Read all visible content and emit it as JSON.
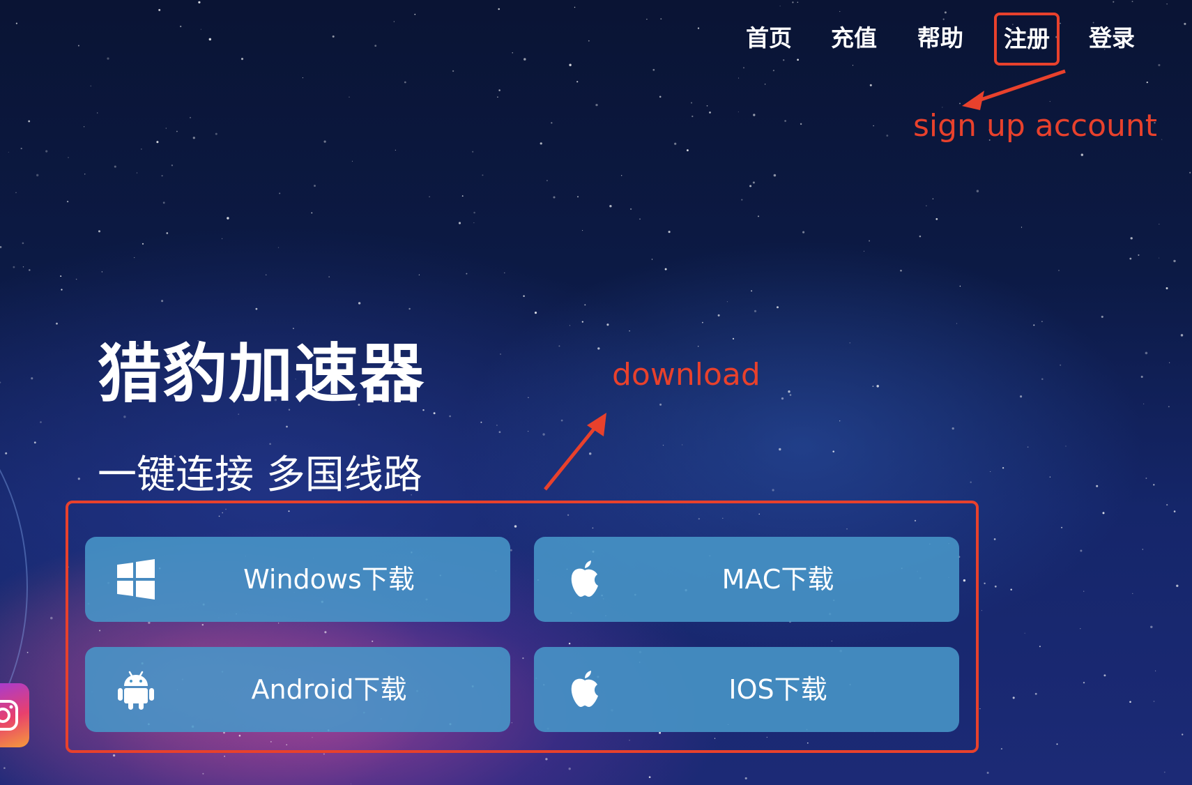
{
  "nav": {
    "items": [
      {
        "label": "首页"
      },
      {
        "label": "充值"
      },
      {
        "label": "帮助"
      },
      {
        "label": "注册"
      },
      {
        "label": "登录"
      }
    ]
  },
  "annotations": {
    "signup": "sign up account",
    "download": "download"
  },
  "hero": {
    "title": "猎豹加速器",
    "subtitle": "一键连接 多国线路"
  },
  "downloads": [
    {
      "label": "Windows下载",
      "icon": "windows-icon"
    },
    {
      "label": "MAC下载",
      "icon": "apple-icon"
    },
    {
      "label": "Android下载",
      "icon": "android-icon"
    },
    {
      "label": "IOS下载",
      "icon": "apple-icon"
    }
  ],
  "colors": {
    "accent": "#e8412c",
    "button_bg": "#4896c8",
    "text": "#ffffff"
  }
}
